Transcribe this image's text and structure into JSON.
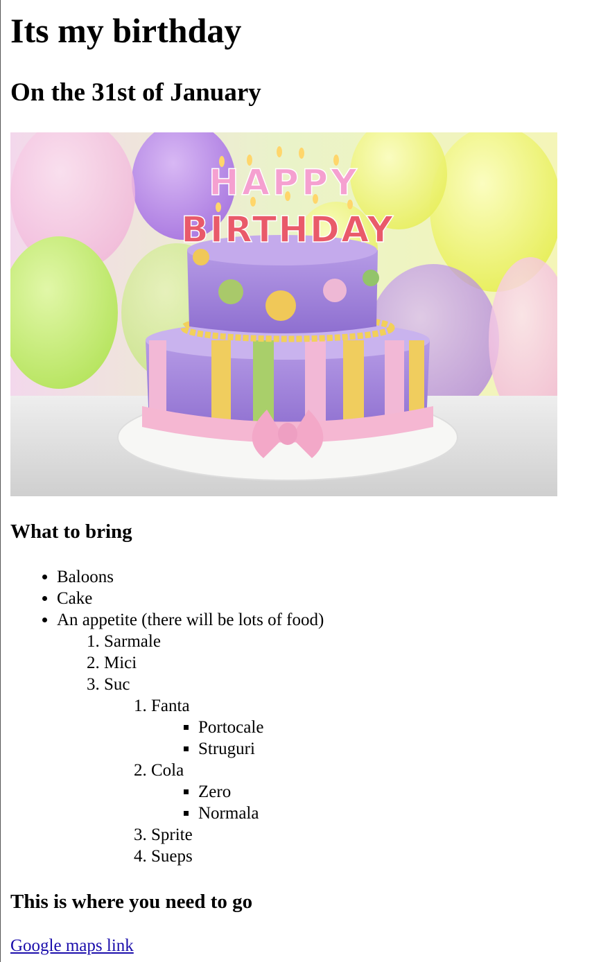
{
  "page": {
    "title": "Its my birthday",
    "subtitle": "On the 31st of January",
    "image_banner": {
      "top_word": "HAPPY",
      "bottom_word": "BIRTHDAY"
    },
    "bring_heading": "What to bring",
    "bring_list": {
      "item1": "Baloons",
      "item2": "Cake",
      "item3": "An appetite (there will be lots of food)",
      "food": {
        "f1": "Sarmale",
        "f2": "Mici",
        "f3": "Suc",
        "drinks": {
          "d1": "Fanta",
          "d1_options": {
            "o1": "Portocale",
            "o2": "Struguri"
          },
          "d2": "Cola",
          "d2_options": {
            "o1": "Zero",
            "o2": "Normala"
          },
          "d3": "Sprite",
          "d4": "Sueps"
        }
      }
    },
    "location_heading": "This is where you need to go",
    "map_link": "Google maps link"
  }
}
